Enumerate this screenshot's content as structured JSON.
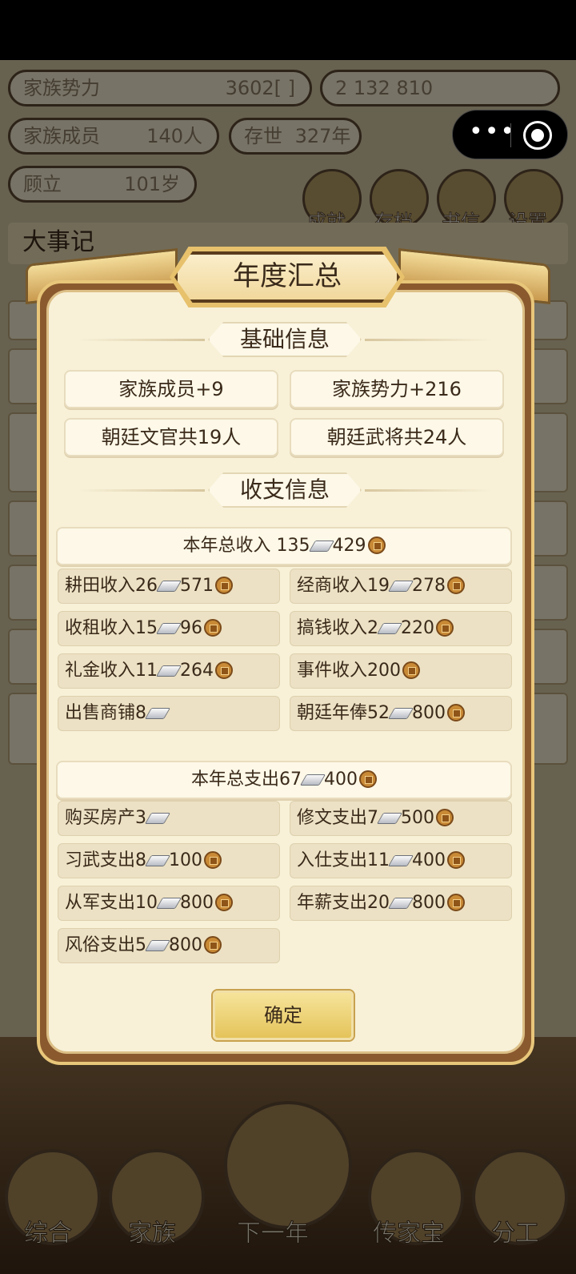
{
  "background": {
    "top_pills": {
      "family_power_label": "家族势力",
      "family_power_value": "3602",
      "family_power_rank": "[      ]",
      "currency_display": "2  132  810",
      "members_label": "家族成员",
      "members_value": "140人",
      "existence_label": "存世",
      "existence_value": "327年",
      "age_label": "顾立",
      "age_value": "101岁"
    },
    "menu_buttons": [
      "成就",
      "存档",
      "书信",
      "设置"
    ],
    "events_title": "大事记",
    "bottom_nav": [
      "综合",
      "家族",
      "下一年",
      "传家宝",
      "分工"
    ]
  },
  "modal": {
    "title": "年度汇总",
    "basic_header": "基础信息",
    "basic_items": [
      "家族成员+9",
      "家族势力+216",
      "朝廷文官共19人",
      "朝廷武将共24人"
    ],
    "finance_header": "收支信息",
    "income_total": {
      "label": "本年总收入 135",
      "silver_suffix": "429"
    },
    "income_items": [
      {
        "label": "耕田收入26",
        "after_silver": "571",
        "has_silver": true,
        "has_coin": true
      },
      {
        "label": "经商收入19",
        "after_silver": "278",
        "has_silver": true,
        "has_coin": true
      },
      {
        "label": "收租收入15",
        "after_silver": "96",
        "has_silver": true,
        "has_coin": true
      },
      {
        "label": "搞钱收入2",
        "after_silver": "220",
        "has_silver": true,
        "has_coin": true
      },
      {
        "label": "礼金收入11",
        "after_silver": "264",
        "has_silver": true,
        "has_coin": true
      },
      {
        "label": "事件收入200",
        "after_silver": "",
        "has_silver": false,
        "has_coin": true
      },
      {
        "label": "出售商铺8",
        "after_silver": "",
        "has_silver": true,
        "has_coin": false
      },
      {
        "label": "朝廷年俸52",
        "after_silver": "800",
        "has_silver": true,
        "has_coin": true
      }
    ],
    "expense_total": {
      "label": "本年总支出67",
      "silver_suffix": "400"
    },
    "expense_items": [
      {
        "label": "购买房产3",
        "after_silver": "",
        "has_silver": true,
        "has_coin": false
      },
      {
        "label": "修文支出7",
        "after_silver": "500",
        "has_silver": true,
        "has_coin": true
      },
      {
        "label": "习武支出8",
        "after_silver": "100",
        "has_silver": true,
        "has_coin": true
      },
      {
        "label": "入仕支出11",
        "after_silver": "400",
        "has_silver": true,
        "has_coin": true
      },
      {
        "label": "从军支出10",
        "after_silver": "800",
        "has_silver": true,
        "has_coin": true
      },
      {
        "label": "年薪支出20",
        "after_silver": "800",
        "has_silver": true,
        "has_coin": true
      },
      {
        "label": "风俗支出5",
        "after_silver": "800",
        "has_silver": true,
        "has_coin": true
      }
    ],
    "confirm_label": "确定"
  },
  "icons": {
    "silver": "silver-ingot-icon",
    "coin": "copper-coin-icon",
    "capsule_more": "more-dots-icon",
    "capsule_close": "close-target-icon"
  },
  "colors": {
    "modal_bg": "#f8f1d8",
    "frame": "#8a5a2e",
    "button": "#e4c35a"
  }
}
